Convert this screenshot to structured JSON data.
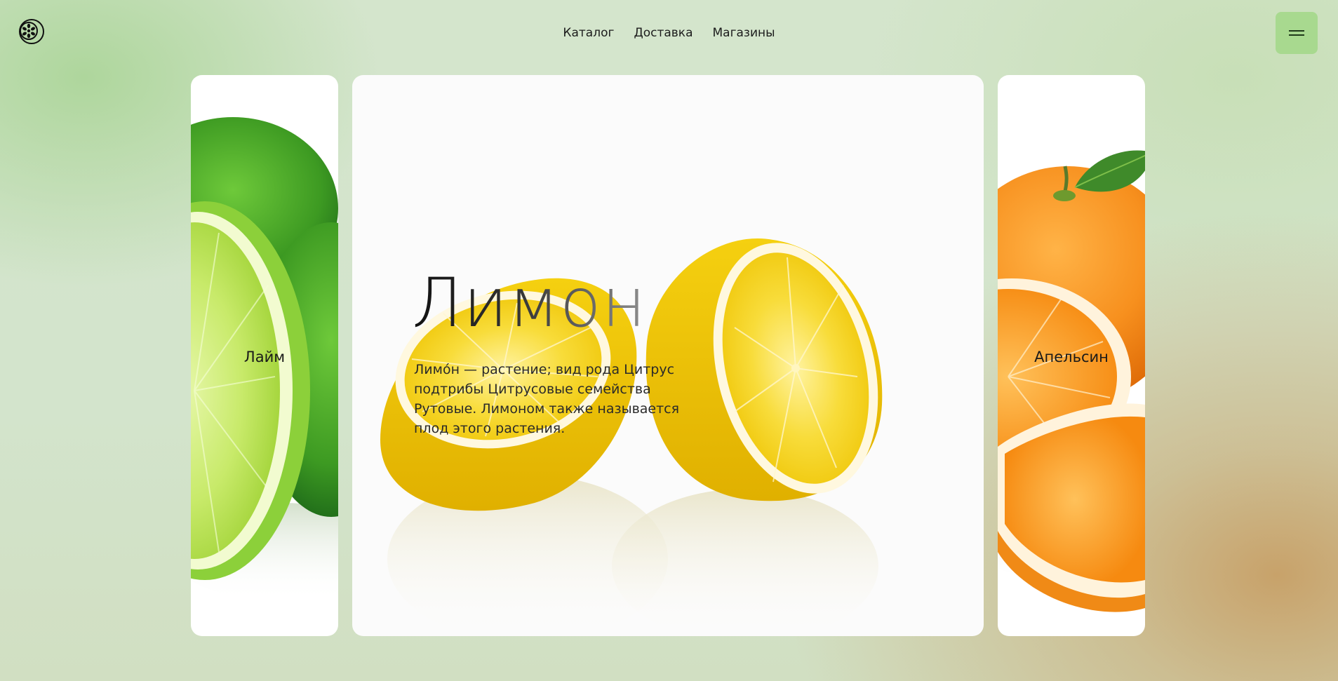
{
  "header": {
    "logo_icon": "citrus-slice-logo-icon",
    "nav": [
      {
        "label": "Каталог"
      },
      {
        "label": "Доставка"
      },
      {
        "label": "Магазины"
      }
    ],
    "menu_icon": "hamburger-menu-icon",
    "menu_button_color": "#a8d98f"
  },
  "slider": {
    "prev": {
      "label": "Лайм",
      "image": "lime-image"
    },
    "current": {
      "title": "Лимон",
      "description": "Лимо́н — растение; вид рода Цитрус подтрибы Цитрусовые семейства Рутовые. Лимоном также называется плод этого растения.",
      "image": "lemon-halves-image"
    },
    "next": {
      "label": "Апельсин",
      "image": "orange-image"
    }
  },
  "colors": {
    "lime": "#6cc12f",
    "lemon": "#f5d313",
    "orange": "#f7901e",
    "accent_green": "#a8d98f"
  }
}
